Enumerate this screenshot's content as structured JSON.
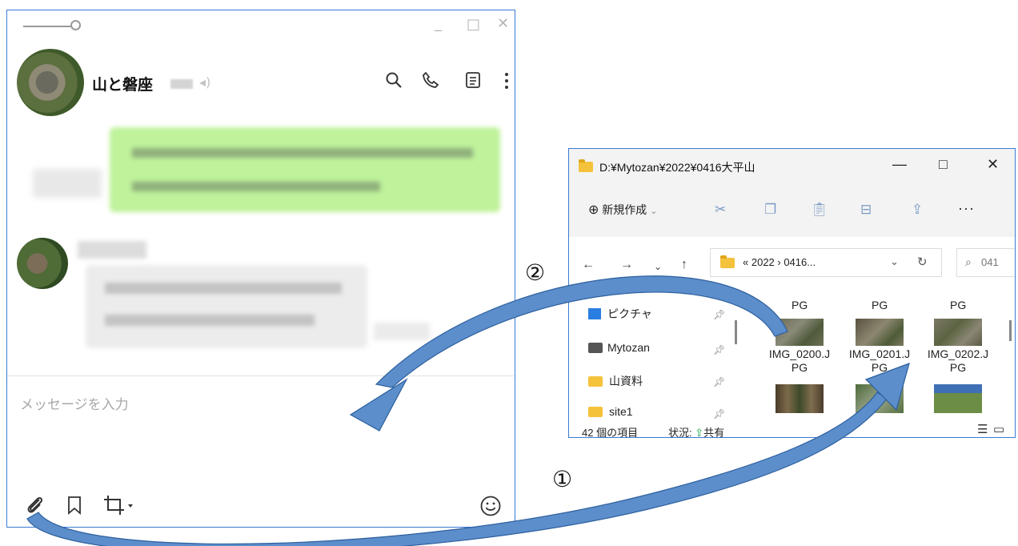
{
  "chat": {
    "title": "山と磐座",
    "window_controls": {
      "minimize": "_",
      "maximize": "□",
      "close": "✕"
    },
    "header_icons": [
      "search-icon",
      "phone-icon",
      "notes-icon",
      "more-icon"
    ],
    "input_placeholder": "メッセージを入力",
    "footer_icons": [
      "attach-icon",
      "bookmark-icon",
      "crop-icon",
      "emoji-icon"
    ]
  },
  "explorer": {
    "title": "D:¥Mytozan¥2022¥0416大平山",
    "window_controls": {
      "minimize": "—",
      "maximize": "□",
      "close": "✕"
    },
    "toolbar": {
      "new_label": "新規作成",
      "more": "···"
    },
    "address": {
      "prefix": "«",
      "path": "2022 › 0416...",
      "chevron": "⌄",
      "refresh": "↻"
    },
    "search_text": "041",
    "nav": [
      {
        "label": "ピクチャ",
        "icon": "pictures-icon"
      },
      {
        "label": "Mytozan",
        "icon": "camera-folder-icon"
      },
      {
        "label": "山資料",
        "icon": "folder-icon"
      },
      {
        "label": "site1",
        "icon": "folder-icon"
      }
    ],
    "files_top_labels": [
      "PG",
      "PG",
      "PG"
    ],
    "files": [
      {
        "name_l1": "IMG_0200.J",
        "name_l2": "PG"
      },
      {
        "name_l1": "IMG_0201.J",
        "name_l2": "PG"
      },
      {
        "name_l1": "IMG_0202.J",
        "name_l2": "PG"
      }
    ],
    "status": {
      "count": "42 個の項目",
      "state_label": "状況:",
      "state_value": "共有"
    },
    "accent": "#3a7bd5",
    "folder_color": "#f5c23b"
  },
  "annotations": {
    "step1": "①",
    "step2": "②",
    "arrow_color": "#5b8ecb"
  }
}
